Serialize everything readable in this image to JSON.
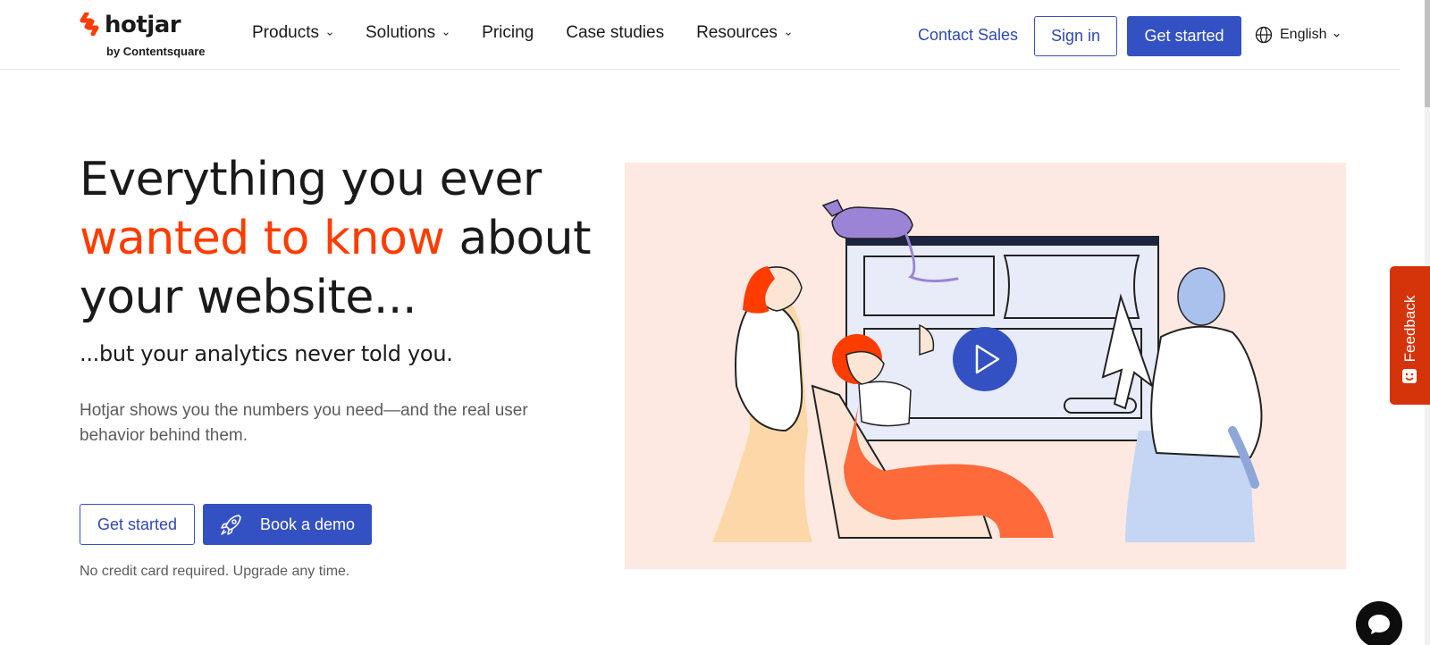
{
  "header": {
    "logo_text": "hotjar",
    "logo_sub": "by Contentsquare",
    "nav": [
      {
        "label": "Products",
        "has_dropdown": true
      },
      {
        "label": "Solutions",
        "has_dropdown": true
      },
      {
        "label": "Pricing",
        "has_dropdown": false
      },
      {
        "label": "Case studies",
        "has_dropdown": false
      },
      {
        "label": "Resources",
        "has_dropdown": true
      }
    ],
    "contact_sales": "Contact Sales",
    "sign_in": "Sign in",
    "get_started": "Get started",
    "language": "English"
  },
  "hero": {
    "title_line1": "Everything you ever",
    "title_accent": "wanted to know",
    "title_rest": " about your website...",
    "subtitle": "...but your analytics never told you.",
    "description": "Hotjar shows you the numbers you need—and the real user behavior behind them.",
    "cta_primary": "Get started",
    "cta_demo": "Book a demo",
    "note": "No credit card required. Upgrade any time."
  },
  "feedback": {
    "label": "Feedback"
  },
  "colors": {
    "accent_orange": "#ff3c00",
    "brand_blue": "#3451c3",
    "feedback_red": "#d5340a",
    "illustration_bg": "#fde9e2"
  },
  "icons": [
    "hotjar-logo-icon",
    "chevron-down-icon",
    "globe-icon",
    "rocket-icon",
    "play-icon",
    "feedback-smile-icon",
    "chat-icon"
  ]
}
